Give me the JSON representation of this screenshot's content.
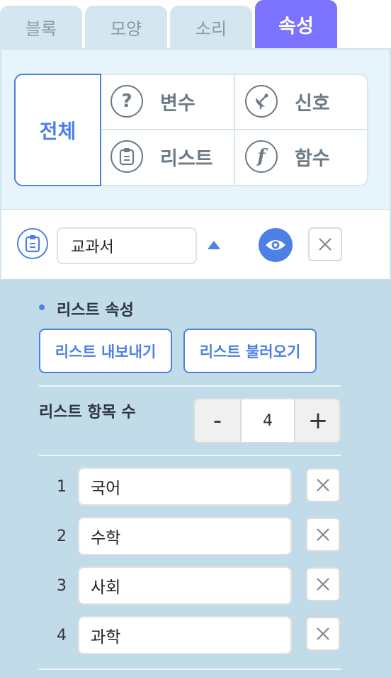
{
  "tabs": [
    {
      "label": "블록",
      "active": false
    },
    {
      "label": "모양",
      "active": false
    },
    {
      "label": "소리",
      "active": false
    },
    {
      "label": "속성",
      "active": true
    }
  ],
  "categories": {
    "all": "전체",
    "variable": {
      "label": "변수",
      "icon": "question-icon"
    },
    "signal": {
      "label": "신호",
      "icon": "satellite-dish-icon"
    },
    "list": {
      "label": "리스트",
      "icon": "clipboard-icon"
    },
    "function": {
      "label": "함수",
      "icon": "function-icon"
    }
  },
  "selected_list": {
    "name": "교과서",
    "icon": "clipboard-icon",
    "visible": true
  },
  "list_properties": {
    "title": "리스트 속성",
    "export_label": "리스트 내보내기",
    "import_label": "리스트 불러오기",
    "count_label": "리스트 항목 수",
    "count_minus": "-",
    "count_plus": "+",
    "count_value": "4",
    "items": [
      {
        "index": "1",
        "value": "국어"
      },
      {
        "index": "2",
        "value": "수학"
      },
      {
        "index": "3",
        "value": "사회"
      },
      {
        "index": "4",
        "value": "과학"
      }
    ]
  },
  "colors": {
    "accent": "#4d80e4",
    "active_tab": "#7b73ff",
    "panel_bg": "#c2dbe8"
  }
}
